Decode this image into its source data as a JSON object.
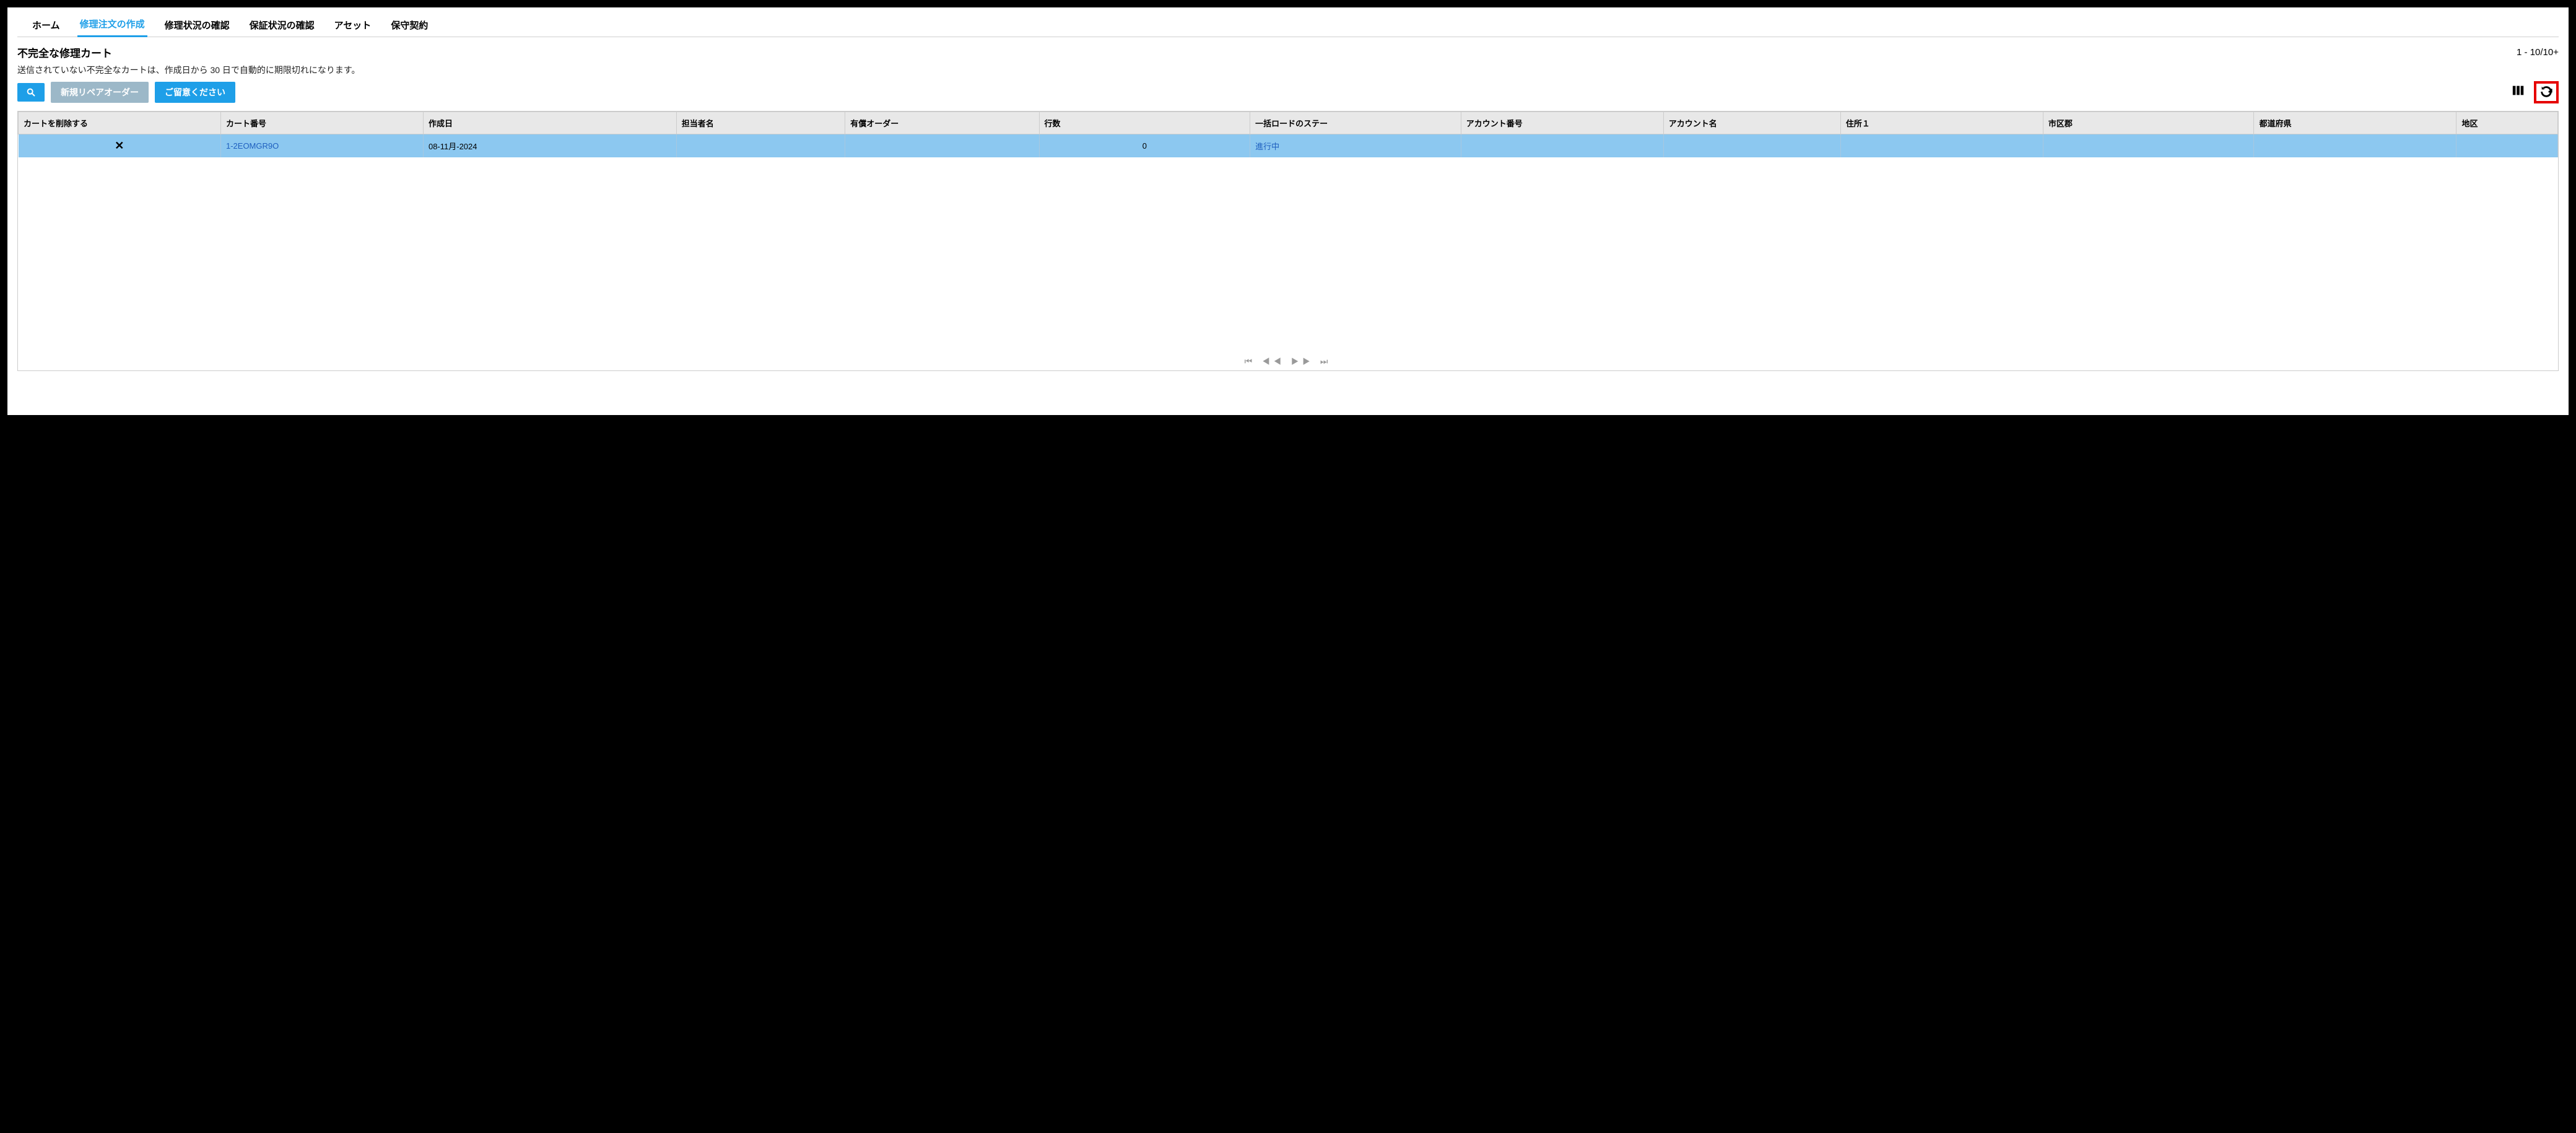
{
  "tabs": [
    {
      "label": "ホーム"
    },
    {
      "label": "修理注文の作成",
      "active": true
    },
    {
      "label": "修理状況の確認"
    },
    {
      "label": "保証状況の確認"
    },
    {
      "label": "アセット"
    },
    {
      "label": "保守契約"
    }
  ],
  "page": {
    "title": "不完全な修理カート",
    "count_label": "1 - 10/10+",
    "subtitle": "送信されていない不完全なカートは、作成日から 30 日で自動的に期限切れになります。"
  },
  "actions": {
    "new_repair_order": "新規リペアオーダー",
    "please_note": "ご留意ください"
  },
  "table": {
    "columns": {
      "delete": "カートを削除する",
      "cart_no": "カート番号",
      "created": "作成日",
      "contact": "担当者名",
      "paid": "有償オーダー",
      "lines": "行数",
      "bulk": "一括ロードのステー",
      "acct_no": "アカウント番号",
      "acct_nm": "アカウント名",
      "addr1": "住所１",
      "city": "市区郡",
      "pref": "都道府県",
      "region": "地区"
    },
    "rows": [
      {
        "cart_no": "1-2EOMGR9O",
        "created": "08-11月-2024",
        "contact": "",
        "paid": "",
        "lines": "0",
        "bulk": "進行中",
        "acct_no": "",
        "acct_nm": "",
        "addr1": "",
        "city": "",
        "pref": "",
        "region": ""
      }
    ]
  }
}
